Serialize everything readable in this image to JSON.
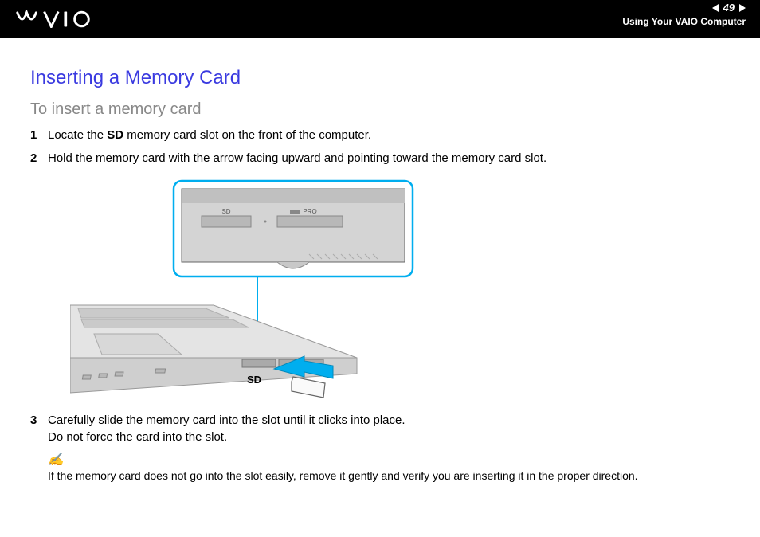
{
  "header": {
    "page_number": "49",
    "section_label": "Using Your VAIO Computer"
  },
  "title": "Inserting a Memory Card",
  "subtitle": "To insert a memory card",
  "steps": [
    {
      "num": "1",
      "before": "Locate the ",
      "bold": "SD",
      "after": " memory card slot on the front of the computer."
    },
    {
      "num": "2",
      "before": "Hold the memory card with the arrow facing upward and pointing toward the memory card slot.",
      "bold": "",
      "after": ""
    },
    {
      "num": "3",
      "before": "Carefully slide the memory card into the slot until it clicks into place.",
      "bold": "",
      "after": "",
      "line2": "Do not force the card into the slot."
    }
  ],
  "illustration": {
    "slot_label_sd": "SD",
    "slot_label_pro": "PRO",
    "card_label": "SD"
  },
  "note": {
    "icon": "✍",
    "text": "If the memory card does not go into the slot easily, remove it gently and verify you are inserting it in the proper direction."
  }
}
